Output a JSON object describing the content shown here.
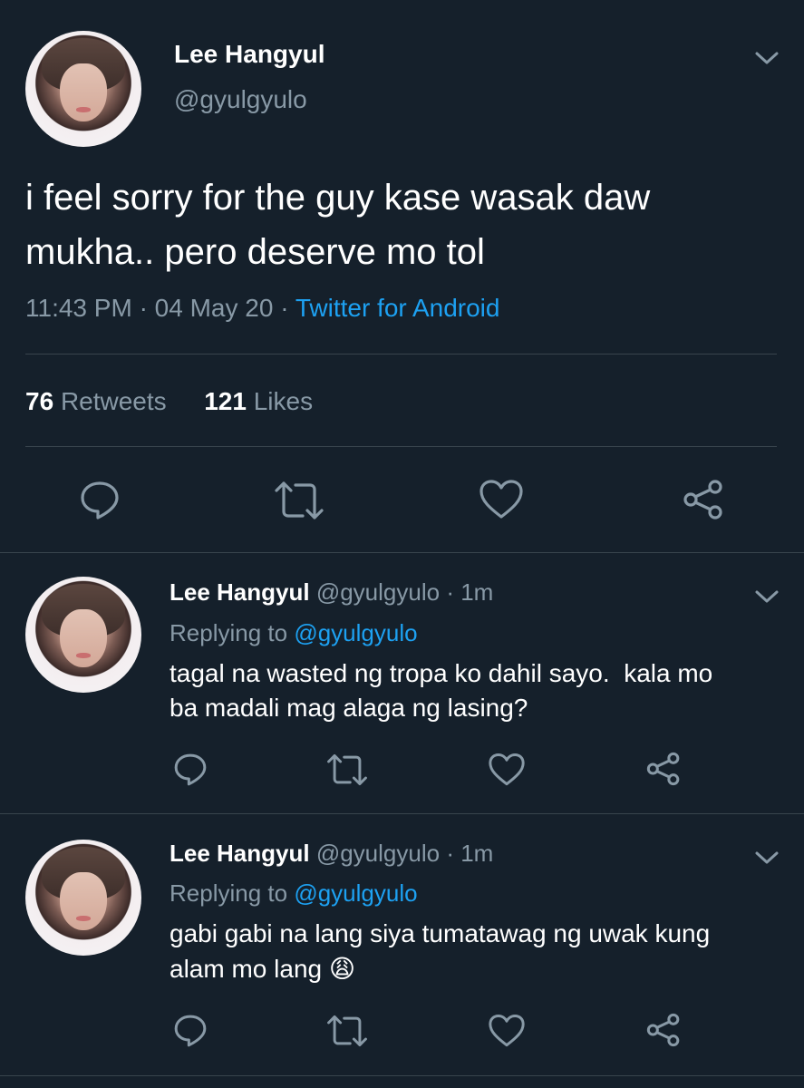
{
  "main_tweet": {
    "display_name": "Lee Hangyul",
    "handle": "@gyulgyulo",
    "text_line1": "i feel sorry for the guy kase wasak daw",
    "text_line2": "mukha.. pero deserve mo tol",
    "time": "11:43 PM",
    "sep1": "·",
    "date": "04 May 20",
    "sep2": "·",
    "source": "Twitter for Android",
    "retweets_count": "76",
    "retweets_label": "Retweets",
    "likes_count": "121",
    "likes_label": "Likes"
  },
  "replies": [
    {
      "display_name": "Lee Hangyul",
      "handle": "@gyulgyulo",
      "sep": "·",
      "time": "1m",
      "replying_label": "Replying to",
      "replying_handle": "@gyulgyulo",
      "text_line1": "tagal na wasted ng tropa ko dahil sayo.  kala mo",
      "text_line2": "ba madali mag alaga ng lasing?"
    },
    {
      "display_name": "Lee Hangyul",
      "handle": "@gyulgyulo",
      "sep": "·",
      "time": "1m",
      "replying_label": "Replying to",
      "replying_handle": "@gyulgyulo",
      "text_line1": "gabi gabi na lang siya tumatawag ng uwak kung",
      "text_line2": "alam mo lang",
      "emoji": "😩"
    }
  ],
  "colors": {
    "background": "#15202b",
    "text": "#ffffff",
    "muted": "#8899a6",
    "accent": "#1da1f2",
    "divider": "#38444d"
  },
  "icons": [
    "chevron-down-icon",
    "reply-icon",
    "retweet-icon",
    "like-icon",
    "share-icon"
  ]
}
